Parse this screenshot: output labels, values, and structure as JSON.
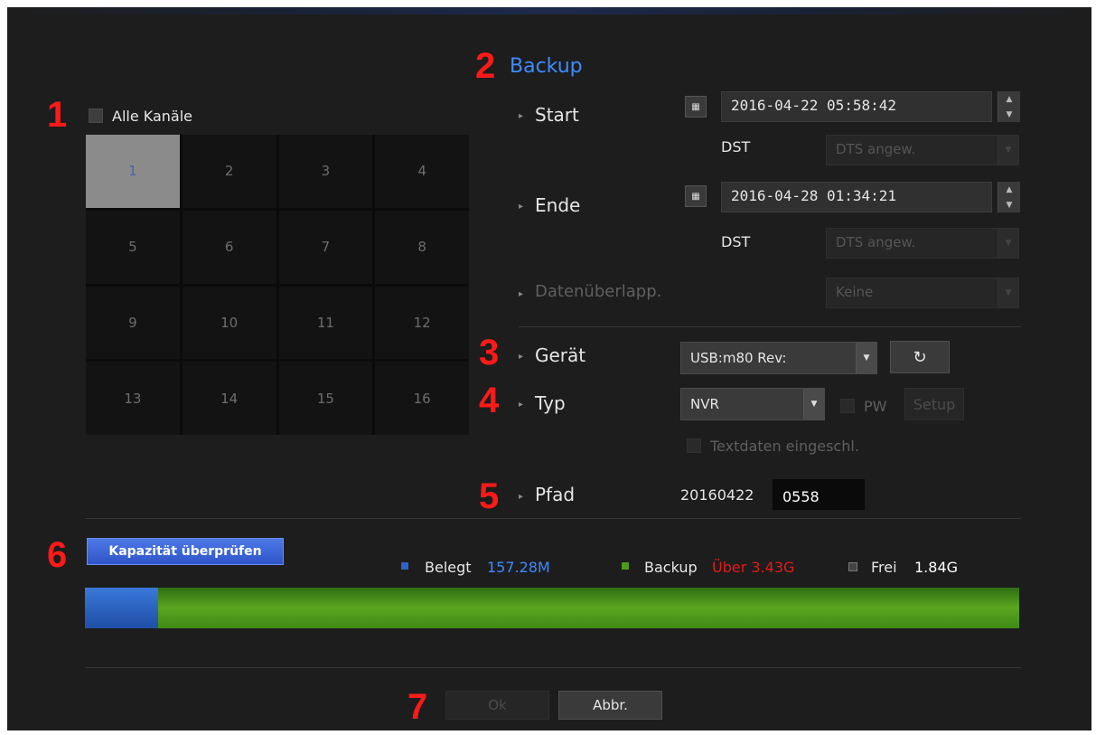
{
  "markers": [
    "1",
    "2",
    "3",
    "4",
    "5",
    "6",
    "7"
  ],
  "section_title": "Backup",
  "channels": {
    "all_label": "Alle Kanäle",
    "cells": [
      "1",
      "2",
      "3",
      "4",
      "5",
      "6",
      "7",
      "8",
      "9",
      "10",
      "11",
      "12",
      "13",
      "14",
      "15",
      "16"
    ],
    "selected": "1"
  },
  "start": {
    "label": "Start",
    "value": "2016-04-22 05:58:42",
    "dst_label": "DST",
    "dst_value": "DTS angew."
  },
  "end": {
    "label": "Ende",
    "value": "2016-04-28 01:34:21",
    "dst_label": "DST",
    "dst_value": "DTS angew."
  },
  "overlap": {
    "label": "Datenüberlapp.",
    "value": "Keine"
  },
  "device": {
    "label": "Gerät",
    "value": "USB:m80 Rev:"
  },
  "type": {
    "label": "Typ",
    "value": "NVR",
    "pw_label": "PW",
    "setup_label": "Setup",
    "textdata_label": "Textdaten eingeschl."
  },
  "path": {
    "label": "Pfad",
    "prefix": "20160422",
    "value": "0558"
  },
  "capacity": {
    "check_button": "Kapazität überprüfen",
    "used_label": "Belegt",
    "used_value": "157.28M",
    "backup_label": "Backup",
    "backup_value": "Über 3.43G",
    "free_label": "Frei",
    "free_value": "1.84G",
    "used_fraction": 0.078,
    "colors": {
      "used": "#2f62c8",
      "backup": "#4e9a1c",
      "over": "#e01b1b",
      "accent": "#3f8bff"
    }
  },
  "buttons": {
    "ok": "Ok",
    "cancel": "Abbr."
  }
}
